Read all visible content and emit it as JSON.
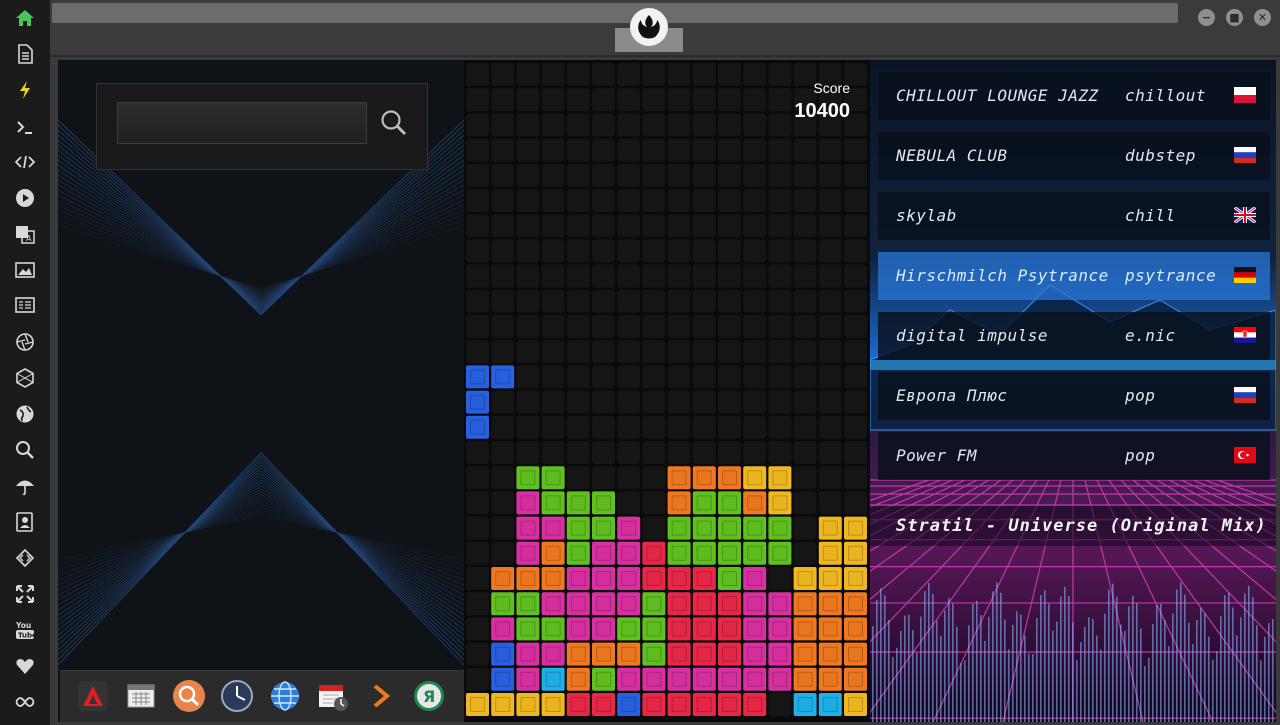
{
  "sidebar": {
    "icons": [
      "home-icon",
      "document-icon",
      "bolt-icon",
      "terminal-icon",
      "code-icon",
      "play-icon",
      "translate-icon",
      "image-icon",
      "news-icon",
      "aperture-icon",
      "hexagon-icon",
      "globe-icon",
      "search-icon",
      "umbrella-icon",
      "contacts-icon",
      "diamond-code-icon",
      "fullscreen-icon",
      "youtube-icon",
      "heart-icon",
      "infinity-icon"
    ]
  },
  "window": {
    "minimize": "−",
    "maximize": "■",
    "close": "✕"
  },
  "search": {
    "value": "",
    "placeholder": ""
  },
  "dock": {
    "apps": [
      "app-a-icon",
      "calendar-grid-icon",
      "magnifier-icon",
      "clock-icon",
      "globe-icon",
      "calendar-clock-icon",
      "arrow-right-icon",
      "yandex-icon"
    ]
  },
  "game": {
    "score_label": "Score",
    "score_value": "10400",
    "cols": 16,
    "rows": 26,
    "colors": {
      "Y": "#f0b820",
      "O": "#f07820",
      "G": "#60c020",
      "M": "#d830a0",
      "R": "#e82848",
      "B": "#2860e0",
      "C": "#20b0e8",
      "empty": "#151515"
    },
    "grid": [
      "................",
      "................",
      "................",
      "................",
      "................",
      "................",
      "................",
      "................",
      "................",
      "................",
      "................",
      "................",
      "BB..............",
      "B...............",
      "B...............",
      "................",
      "..GG....OOOYY...",
      "..MGGG..OGGOY...",
      "..MMGGM.GGGGG.YY",
      "..MOGMMRGGGGG.YY",
      ".OOOMMMRRRGM.YYY",
      ".GGMMMMGRRRMMOOO",
      ".MGGMMGGRRRMMOOO",
      ".BMMOOOGRRRMMOOO",
      ".BMCOGMMMMMMMOOO",
      "YYYYRRBRRRRR.CCY"
    ]
  },
  "radio": {
    "stations": [
      {
        "name": "CHILLOUT LOUNGE JAZZ",
        "genre": "chillout",
        "flag": "poland"
      },
      {
        "name": "NEBULA CLUB",
        "genre": "dubstep",
        "flag": "russia"
      },
      {
        "name": "skylab",
        "genre": "chill",
        "flag": "uk"
      },
      {
        "name": "Hirschmilch Psytrance",
        "genre": "psytrance",
        "flag": "germany"
      },
      {
        "name": "digital impulse",
        "genre": "e.nic",
        "flag": "croatia"
      },
      {
        "name": "Европа Плюс",
        "genre": "pop",
        "flag": "russia"
      },
      {
        "name": "Power FM",
        "genre": "pop",
        "flag": "turkey"
      }
    ],
    "active_index": 3,
    "now_playing": "Stratil - Universe (Original Mix)"
  }
}
